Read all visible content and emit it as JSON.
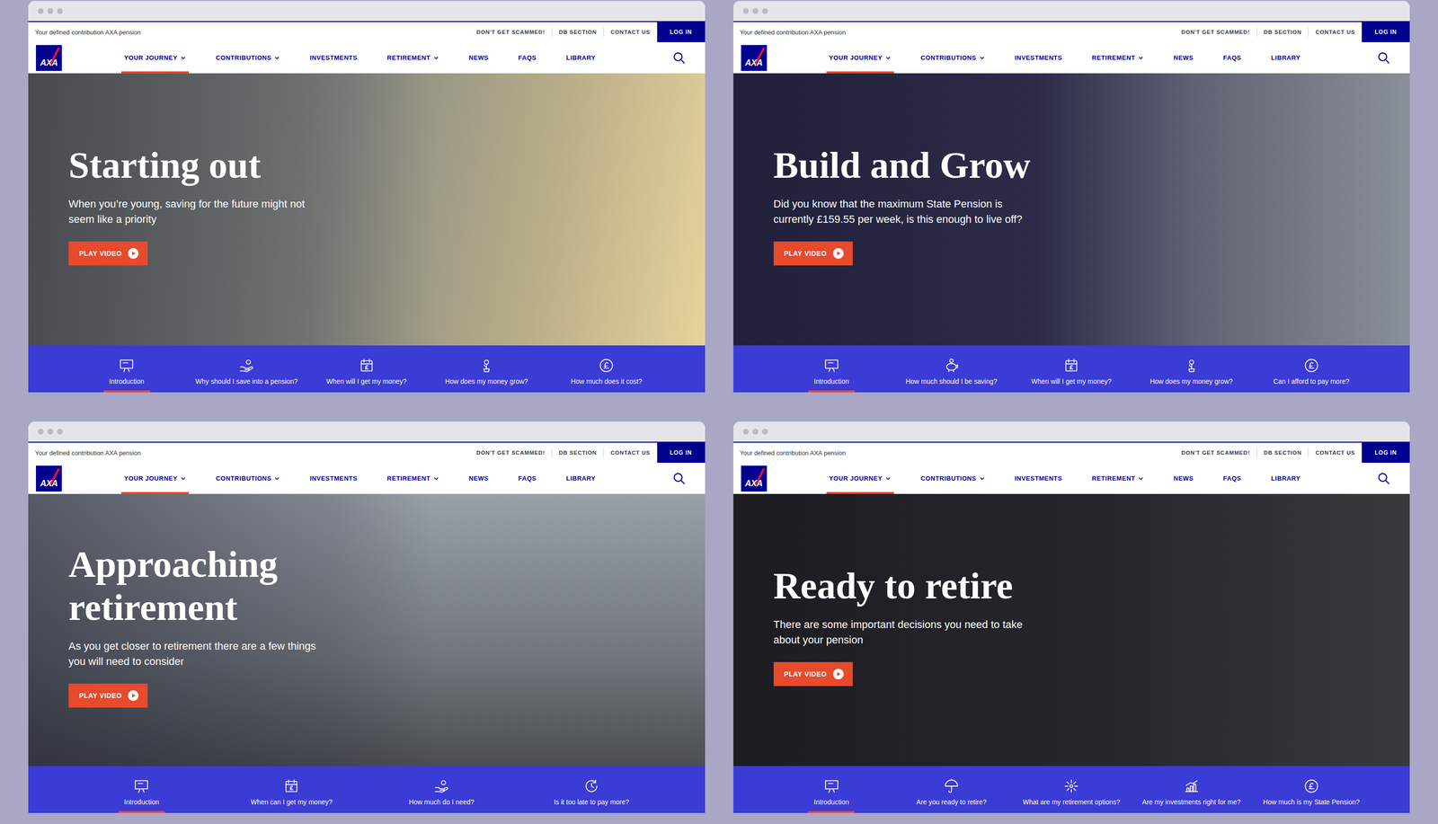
{
  "windows": [
    {
      "utility_bar": {
        "tagline": "Your defined contribution AXA pension",
        "links": [
          "DON'T GET SCAMMED!",
          "DB SECTION",
          "CONTACT US"
        ],
        "login": "LOG IN"
      },
      "logo": "AXA",
      "nav": [
        {
          "label": "YOUR JOURNEY",
          "dropdown": true,
          "selected": true
        },
        {
          "label": "CONTRIBUTIONS",
          "dropdown": true,
          "selected": false
        },
        {
          "label": "INVESTMENTS",
          "dropdown": false,
          "selected": false
        },
        {
          "label": "RETIREMENT",
          "dropdown": true,
          "selected": false
        },
        {
          "label": "NEWS",
          "dropdown": false,
          "selected": false
        },
        {
          "label": "FAQS",
          "dropdown": false,
          "selected": false
        },
        {
          "label": "LIBRARY",
          "dropdown": false,
          "selected": false
        }
      ],
      "hero": {
        "title": "Starting out",
        "subtitle": "When you’re young, saving for the future might not seem like a priority",
        "button": "PLAY VIDEO"
      },
      "tabs": [
        {
          "label": "Introduction",
          "selected": true
        },
        {
          "label": "Why should I save into a pension?",
          "selected": false
        },
        {
          "label": "When will I get my money?",
          "selected": false
        },
        {
          "label": "How does my money grow?",
          "selected": false
        },
        {
          "label": "How much does it cost?",
          "selected": false
        }
      ]
    },
    {
      "utility_bar": {
        "tagline": "Your defined contribution AXA pension",
        "links": [
          "DON'T GET SCAMMED!",
          "DB SECTION",
          "CONTACT US"
        ],
        "login": "LOG IN"
      },
      "logo": "AXA",
      "nav": [
        {
          "label": "YOUR JOURNEY",
          "dropdown": true,
          "selected": true
        },
        {
          "label": "CONTRIBUTIONS",
          "dropdown": true,
          "selected": false
        },
        {
          "label": "INVESTMENTS",
          "dropdown": false,
          "selected": false
        },
        {
          "label": "RETIREMENT",
          "dropdown": true,
          "selected": false
        },
        {
          "label": "NEWS",
          "dropdown": false,
          "selected": false
        },
        {
          "label": "FAQS",
          "dropdown": false,
          "selected": false
        },
        {
          "label": "LIBRARY",
          "dropdown": false,
          "selected": false
        }
      ],
      "hero": {
        "title": "Build and Grow",
        "subtitle": "Did you know that the maximum State Pension is currently £159.55 per week, is this enough to live off?",
        "button": "PLAY VIDEO"
      },
      "tabs": [
        {
          "label": "Introduction",
          "selected": true
        },
        {
          "label": "How much should I be saving?",
          "selected": false
        },
        {
          "label": "When will I get my money?",
          "selected": false
        },
        {
          "label": "How does my money grow?",
          "selected": false
        },
        {
          "label": "Can I afford to pay more?",
          "selected": false
        }
      ]
    },
    {
      "utility_bar": {
        "tagline": "Your defined contribution AXA pension",
        "links": [
          "DON'T GET SCAMMED!",
          "DB SECTION",
          "CONTACT US"
        ],
        "login": "LOG IN"
      },
      "logo": "AXA",
      "nav": [
        {
          "label": "YOUR JOURNEY",
          "dropdown": true,
          "selected": true
        },
        {
          "label": "CONTRIBUTIONS",
          "dropdown": true,
          "selected": false
        },
        {
          "label": "INVESTMENTS",
          "dropdown": false,
          "selected": false
        },
        {
          "label": "RETIREMENT",
          "dropdown": true,
          "selected": false
        },
        {
          "label": "NEWS",
          "dropdown": false,
          "selected": false
        },
        {
          "label": "FAQS",
          "dropdown": false,
          "selected": false
        },
        {
          "label": "LIBRARY",
          "dropdown": false,
          "selected": false
        }
      ],
      "hero": {
        "title": "Approaching retirement",
        "subtitle": "As you get closer to retirement there are a few things you will need to consider",
        "button": "PLAY VIDEO"
      },
      "tabs": [
        {
          "label": "Introduction",
          "selected": true
        },
        {
          "label": "When can I get my money?",
          "selected": false
        },
        {
          "label": "How much do I need?",
          "selected": false
        },
        {
          "label": "Is it too late to pay more?",
          "selected": false
        }
      ]
    },
    {
      "utility_bar": {
        "tagline": "Your defined contribution AXA pension",
        "links": [
          "DON'T GET SCAMMED!",
          "DB SECTION",
          "CONTACT US"
        ],
        "login": "LOG IN"
      },
      "logo": "AXA",
      "nav": [
        {
          "label": "YOUR JOURNEY",
          "dropdown": true,
          "selected": true
        },
        {
          "label": "CONTRIBUTIONS",
          "dropdown": true,
          "selected": false
        },
        {
          "label": "INVESTMENTS",
          "dropdown": false,
          "selected": false
        },
        {
          "label": "RETIREMENT",
          "dropdown": true,
          "selected": false
        },
        {
          "label": "NEWS",
          "dropdown": false,
          "selected": false
        },
        {
          "label": "FAQS",
          "dropdown": false,
          "selected": false
        },
        {
          "label": "LIBRARY",
          "dropdown": false,
          "selected": false
        }
      ],
      "hero": {
        "title": "Ready to retire",
        "subtitle": "There are some important decisions you need to take about your pension",
        "button": "PLAY VIDEO"
      },
      "tabs": [
        {
          "label": "Introduction",
          "selected": true
        },
        {
          "label": "Are you ready to retire?",
          "selected": false
        },
        {
          "label": "What are my retirement options?",
          "selected": false
        },
        {
          "label": "Are my investments right for me?",
          "selected": false
        },
        {
          "label": "How much is my State Pension?",
          "selected": false
        }
      ]
    }
  ]
}
